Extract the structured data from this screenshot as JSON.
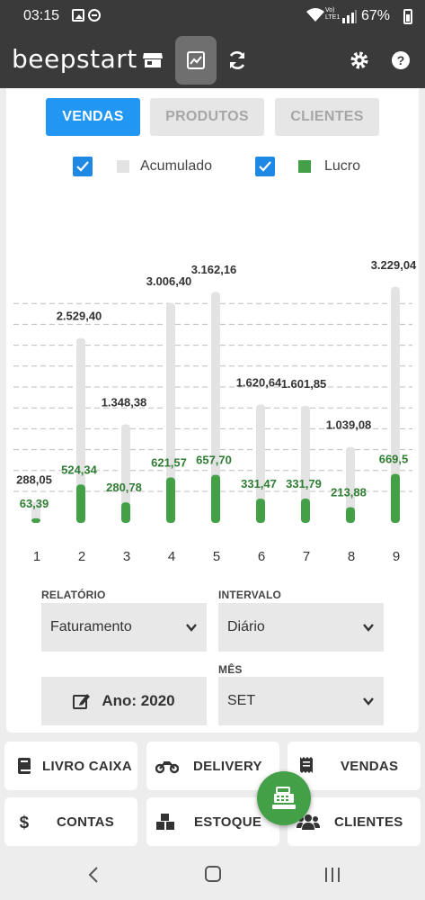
{
  "status_bar": {
    "time": "03:15",
    "lte_text": "Vo)\nLTE1",
    "battery": "67%"
  },
  "app": {
    "logo": "beepstart"
  },
  "tabs": [
    {
      "label": "VENDAS",
      "active": true
    },
    {
      "label": "PRODUTOS",
      "active": false
    },
    {
      "label": "CLIENTES",
      "active": false
    }
  ],
  "legend": {
    "acumulado_label": "Acumulado",
    "lucro_label": "Lucro",
    "acumulado_color": "#e3e3e3",
    "lucro_color": "#43a047"
  },
  "chart_data": {
    "type": "bar",
    "categories": [
      "1",
      "2",
      "3",
      "4",
      "5",
      "6",
      "7",
      "8",
      "9"
    ],
    "series": [
      {
        "name": "Acumulado",
        "values": [
          288.05,
          2529.4,
          1348.38,
          3006.4,
          3162.16,
          1620.64,
          1601.85,
          1039.08,
          3229.04
        ],
        "labels": [
          "288,05",
          "2.529,40",
          "1.348,38",
          "3.006,40",
          "3.162,16",
          "1.620,64",
          "1.601,85",
          "1.039,08",
          "3.229,04"
        ]
      },
      {
        "name": "Lucro",
        "values": [
          63.39,
          524.34,
          280.78,
          621.57,
          657.7,
          331.47,
          331.79,
          213.88,
          669.5
        ],
        "labels": [
          "63,39",
          "524,34",
          "280,78",
          "621,57",
          "657,70",
          "331,47",
          "331,79",
          "213,88",
          "669,5"
        ]
      }
    ],
    "ylim": [
      0,
      3300
    ],
    "grid": true
  },
  "filters": {
    "relatorio_label": "RELATÓRIO",
    "relatorio_value": "Faturamento",
    "intervalo_label": "INTERVALO",
    "intervalo_value": "Diário",
    "mes_label": "MÊS",
    "mes_value": "SET",
    "ano_label": "Ano: 2020"
  },
  "bottom_nav": {
    "livro_caixa": "LIVRO CAIXA",
    "delivery": "DELIVERY",
    "vendas": "VENDAS",
    "contas": "CONTAS",
    "estoque": "ESTOQUE",
    "clientes": "CLIENTES"
  }
}
